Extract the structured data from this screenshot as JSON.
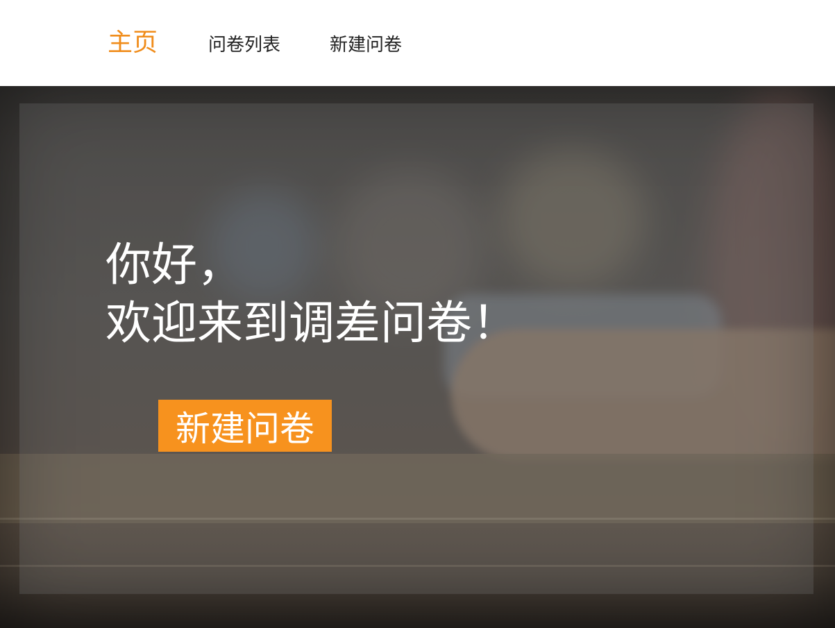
{
  "nav": {
    "home": "主页",
    "list": "问卷列表",
    "new": "新建问卷",
    "active_color": "#f08c1a"
  },
  "hero": {
    "line1": "你好，",
    "line2": "欢迎来到调差问卷！",
    "button": "新建问卷",
    "button_color": "#f7921e"
  }
}
